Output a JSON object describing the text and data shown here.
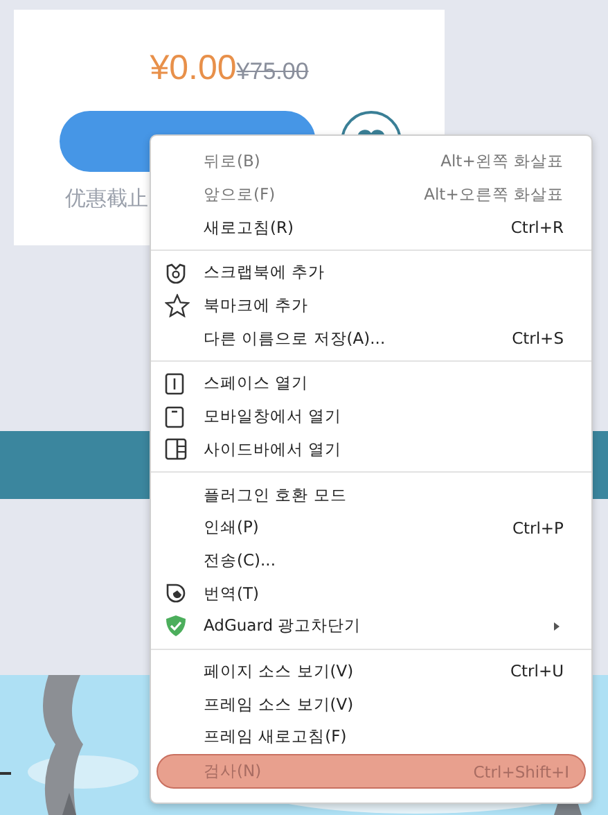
{
  "product_card": {
    "price": "¥0.00",
    "original_price": "¥75.00",
    "deadline_text": "优惠截止"
  },
  "context_menu": {
    "groups": [
      {
        "items": [
          {
            "label": "뒤로(B)",
            "shortcut": "Alt+왼쪽 화살표",
            "disabled": true,
            "highlighted": false
          },
          {
            "label": "앞으로(F)",
            "shortcut": "Alt+오른쪽 화살표",
            "disabled": true,
            "highlighted": false
          },
          {
            "label": "새로고침(R)",
            "shortcut": "Ctrl+R",
            "disabled": false,
            "highlighted": false
          }
        ]
      },
      {
        "items": [
          {
            "label": "스크랩북에 추가",
            "disabled": false,
            "highlighted": false
          },
          {
            "label": "북마크에 추가",
            "disabled": false,
            "highlighted": false
          },
          {
            "label": "다른 이름으로 저장(A)...",
            "shortcut": "Ctrl+S",
            "disabled": false,
            "highlighted": false
          }
        ]
      },
      {
        "items": [
          {
            "label": "스페이스 열기",
            "disabled": false,
            "highlighted": false
          },
          {
            "label": "모바일창에서 열기",
            "disabled": false,
            "highlighted": false
          },
          {
            "label": "사이드바에서 열기",
            "disabled": false,
            "highlighted": false
          }
        ]
      },
      {
        "items": [
          {
            "label": "플러그인 호환 모드",
            "disabled": false,
            "highlighted": false
          },
          {
            "label": "인쇄(P)",
            "shortcut": "Ctrl+P",
            "disabled": false,
            "highlighted": false
          },
          {
            "label": "전송(C)...",
            "disabled": false,
            "highlighted": false
          },
          {
            "label": "번역(T)",
            "disabled": false,
            "highlighted": false
          },
          {
            "label": "AdGuard 광고차단기",
            "submenu": true,
            "disabled": false,
            "highlighted": false
          }
        ]
      },
      {
        "items": [
          {
            "label": "페이지 소스 보기(V)",
            "shortcut": "Ctrl+U",
            "disabled": false,
            "highlighted": false
          },
          {
            "label": "프레임 소스 보기(V)",
            "disabled": false,
            "highlighted": false
          },
          {
            "label": "프레임 새로고침(F)",
            "disabled": false,
            "highlighted": false
          },
          {
            "label": "검사(N)",
            "shortcut": "Ctrl+Shift+I",
            "disabled": false,
            "highlighted": true
          }
        ]
      }
    ]
  }
}
